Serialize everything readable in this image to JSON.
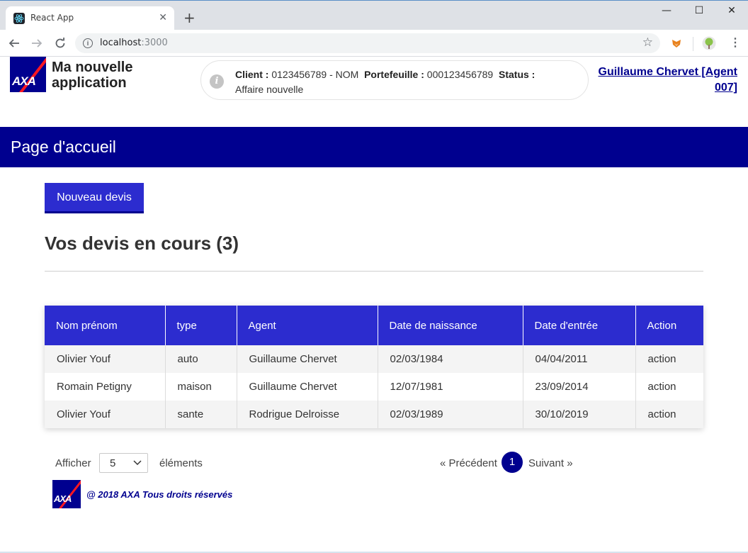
{
  "browser": {
    "tab_title": "React App",
    "tab_close": "✕",
    "new_tab": "+",
    "url_host": "localhost",
    "url_port": ":3000",
    "window_controls": [
      "—",
      "☐",
      "✕"
    ],
    "icons": [
      "react-favicon",
      "back-arrow-icon",
      "forward-arrow-icon",
      "reload-icon",
      "info-icon",
      "star-icon",
      "fox-extension-icon",
      "tree-extension-icon",
      "menu-dots-icon"
    ]
  },
  "header": {
    "logo_text": "AXA",
    "app_name": "Ma nouvelle application",
    "info": {
      "client_label": "Client :",
      "client_value": "0123456789 - NOM",
      "portfolio_label": "Portefeuille :",
      "portfolio_value": "000123456789",
      "status_label": "Status :",
      "status_value": "Affaire nouvelle"
    },
    "user": "Guillaume Chervet [Agent 007]"
  },
  "page": {
    "title": "Page d'accueil",
    "new_quote_button": "Nouveau devis",
    "section_title": "Vos devis en cours (3)"
  },
  "table": {
    "headers": [
      "Nom prénom",
      "type",
      "Agent",
      "Date de naissance",
      "Date d'entrée",
      "Action"
    ],
    "rows": [
      [
        "Olivier Youf",
        "auto",
        "Guillaume Chervet",
        "02/03/1984",
        "04/04/2011",
        "action"
      ],
      [
        "Romain Petigny",
        "maison",
        "Guillaume Chervet",
        "12/07/1981",
        "23/09/2014",
        "action"
      ],
      [
        "Olivier Youf",
        "sante",
        "Rodrigue Delroisse",
        "02/03/1989",
        "30/10/2019",
        "action"
      ]
    ]
  },
  "pagination": {
    "show_label": "Afficher",
    "page_size": "5",
    "elements_label": "éléments",
    "prev": "« Précédent",
    "current_page": "1",
    "next": "Suivant »"
  },
  "footer": {
    "logo_text": "AXA",
    "copyright": "@ 2018 AXA Tous droits réservés"
  },
  "colors": {
    "brand_blue": "#00008f",
    "accent_blue": "#2c2ccf",
    "axa_red": "#ff1721"
  }
}
